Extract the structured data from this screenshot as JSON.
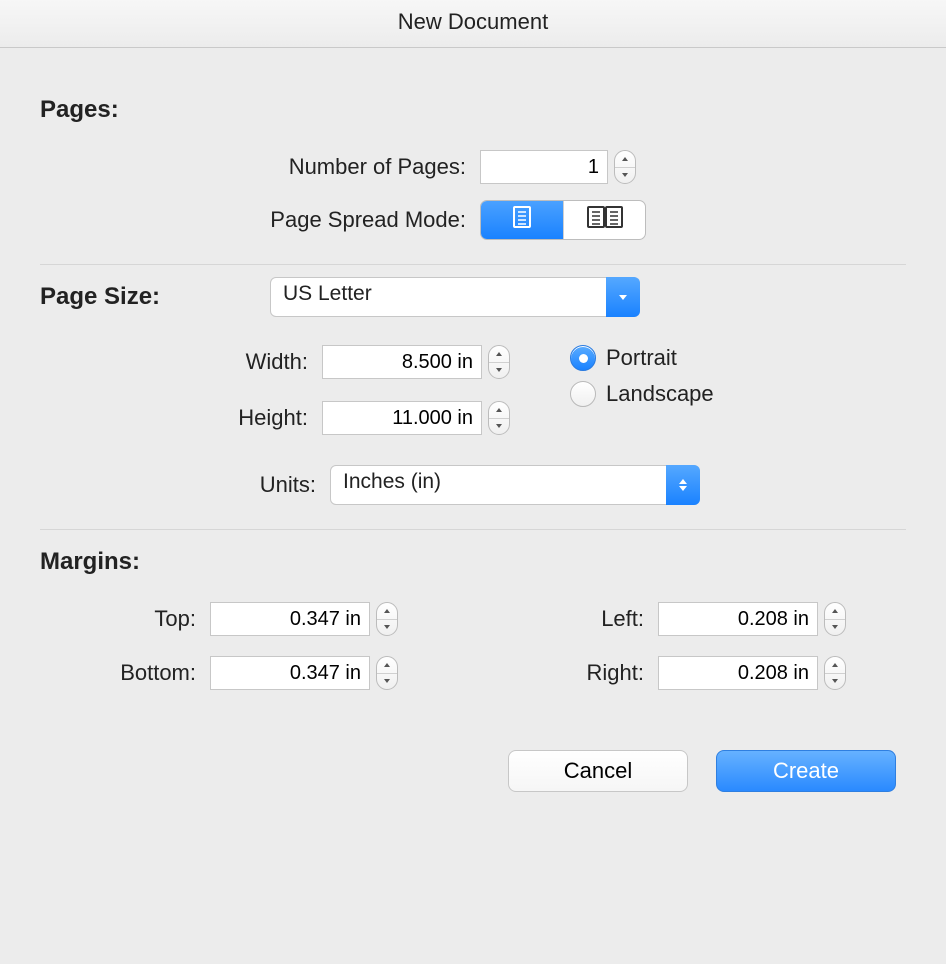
{
  "window": {
    "title": "New Document"
  },
  "pages": {
    "section_label": "Pages:",
    "num_pages_label": "Number of Pages:",
    "num_pages_value": "1",
    "spread_label": "Page Spread Mode:",
    "spread_selected": "single"
  },
  "page_size": {
    "section_label": "Page Size:",
    "preset": "US Letter",
    "width_label": "Width:",
    "width_value": "8.500 in",
    "height_label": "Height:",
    "height_value": "11.000 in",
    "units_label": "Units:",
    "units_value": "Inches (in)",
    "orientation": {
      "portrait_label": "Portrait",
      "landscape_label": "Landscape",
      "selected": "portrait"
    }
  },
  "margins": {
    "section_label": "Margins:",
    "top_label": "Top:",
    "top_value": "0.347 in",
    "bottom_label": "Bottom:",
    "bottom_value": "0.347 in",
    "left_label": "Left:",
    "left_value": "0.208 in",
    "right_label": "Right:",
    "right_value": "0.208 in"
  },
  "buttons": {
    "cancel": "Cancel",
    "create": "Create"
  }
}
